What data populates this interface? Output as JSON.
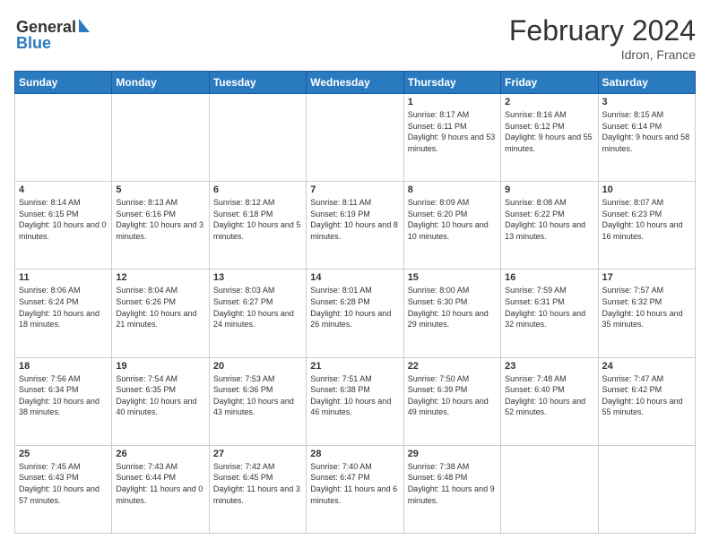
{
  "header": {
    "logo_line1": "General",
    "logo_line2": "Blue",
    "month_title": "February 2024",
    "location": "Idron, France"
  },
  "weekdays": [
    "Sunday",
    "Monday",
    "Tuesday",
    "Wednesday",
    "Thursday",
    "Friday",
    "Saturday"
  ],
  "weeks": [
    [
      {
        "day": "",
        "info": ""
      },
      {
        "day": "",
        "info": ""
      },
      {
        "day": "",
        "info": ""
      },
      {
        "day": "",
        "info": ""
      },
      {
        "day": "1",
        "info": "Sunrise: 8:17 AM\nSunset: 6:11 PM\nDaylight: 9 hours and 53 minutes."
      },
      {
        "day": "2",
        "info": "Sunrise: 8:16 AM\nSunset: 6:12 PM\nDaylight: 9 hours and 55 minutes."
      },
      {
        "day": "3",
        "info": "Sunrise: 8:15 AM\nSunset: 6:14 PM\nDaylight: 9 hours and 58 minutes."
      }
    ],
    [
      {
        "day": "4",
        "info": "Sunrise: 8:14 AM\nSunset: 6:15 PM\nDaylight: 10 hours and 0 minutes."
      },
      {
        "day": "5",
        "info": "Sunrise: 8:13 AM\nSunset: 6:16 PM\nDaylight: 10 hours and 3 minutes."
      },
      {
        "day": "6",
        "info": "Sunrise: 8:12 AM\nSunset: 6:18 PM\nDaylight: 10 hours and 5 minutes."
      },
      {
        "day": "7",
        "info": "Sunrise: 8:11 AM\nSunset: 6:19 PM\nDaylight: 10 hours and 8 minutes."
      },
      {
        "day": "8",
        "info": "Sunrise: 8:09 AM\nSunset: 6:20 PM\nDaylight: 10 hours and 10 minutes."
      },
      {
        "day": "9",
        "info": "Sunrise: 8:08 AM\nSunset: 6:22 PM\nDaylight: 10 hours and 13 minutes."
      },
      {
        "day": "10",
        "info": "Sunrise: 8:07 AM\nSunset: 6:23 PM\nDaylight: 10 hours and 16 minutes."
      }
    ],
    [
      {
        "day": "11",
        "info": "Sunrise: 8:06 AM\nSunset: 6:24 PM\nDaylight: 10 hours and 18 minutes."
      },
      {
        "day": "12",
        "info": "Sunrise: 8:04 AM\nSunset: 6:26 PM\nDaylight: 10 hours and 21 minutes."
      },
      {
        "day": "13",
        "info": "Sunrise: 8:03 AM\nSunset: 6:27 PM\nDaylight: 10 hours and 24 minutes."
      },
      {
        "day": "14",
        "info": "Sunrise: 8:01 AM\nSunset: 6:28 PM\nDaylight: 10 hours and 26 minutes."
      },
      {
        "day": "15",
        "info": "Sunrise: 8:00 AM\nSunset: 6:30 PM\nDaylight: 10 hours and 29 minutes."
      },
      {
        "day": "16",
        "info": "Sunrise: 7:59 AM\nSunset: 6:31 PM\nDaylight: 10 hours and 32 minutes."
      },
      {
        "day": "17",
        "info": "Sunrise: 7:57 AM\nSunset: 6:32 PM\nDaylight: 10 hours and 35 minutes."
      }
    ],
    [
      {
        "day": "18",
        "info": "Sunrise: 7:56 AM\nSunset: 6:34 PM\nDaylight: 10 hours and 38 minutes."
      },
      {
        "day": "19",
        "info": "Sunrise: 7:54 AM\nSunset: 6:35 PM\nDaylight: 10 hours and 40 minutes."
      },
      {
        "day": "20",
        "info": "Sunrise: 7:53 AM\nSunset: 6:36 PM\nDaylight: 10 hours and 43 minutes."
      },
      {
        "day": "21",
        "info": "Sunrise: 7:51 AM\nSunset: 6:38 PM\nDaylight: 10 hours and 46 minutes."
      },
      {
        "day": "22",
        "info": "Sunrise: 7:50 AM\nSunset: 6:39 PM\nDaylight: 10 hours and 49 minutes."
      },
      {
        "day": "23",
        "info": "Sunrise: 7:48 AM\nSunset: 6:40 PM\nDaylight: 10 hours and 52 minutes."
      },
      {
        "day": "24",
        "info": "Sunrise: 7:47 AM\nSunset: 6:42 PM\nDaylight: 10 hours and 55 minutes."
      }
    ],
    [
      {
        "day": "25",
        "info": "Sunrise: 7:45 AM\nSunset: 6:43 PM\nDaylight: 10 hours and 57 minutes."
      },
      {
        "day": "26",
        "info": "Sunrise: 7:43 AM\nSunset: 6:44 PM\nDaylight: 11 hours and 0 minutes."
      },
      {
        "day": "27",
        "info": "Sunrise: 7:42 AM\nSunset: 6:45 PM\nDaylight: 11 hours and 3 minutes."
      },
      {
        "day": "28",
        "info": "Sunrise: 7:40 AM\nSunset: 6:47 PM\nDaylight: 11 hours and 6 minutes."
      },
      {
        "day": "29",
        "info": "Sunrise: 7:38 AM\nSunset: 6:48 PM\nDaylight: 11 hours and 9 minutes."
      },
      {
        "day": "",
        "info": ""
      },
      {
        "day": "",
        "info": ""
      }
    ]
  ]
}
